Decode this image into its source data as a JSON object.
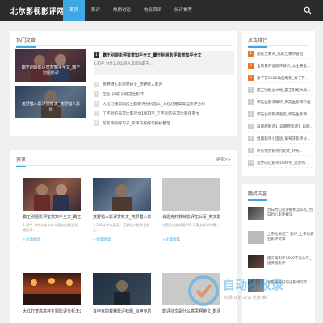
{
  "header": {
    "logo": "北尔影视影评网",
    "nav": [
      "首页",
      "影评",
      "热剧讨论",
      "电影资讯",
      "好评推荐"
    ],
    "active_nav": 0
  },
  "hot": {
    "title": "热门文章",
    "featured": [
      {
        "caption": "霸王别姬影评鉴赏知乎全文_霸王别姬影评"
      },
      {
        "caption": "荒野猎人影评赏析文_荒野猎人影评"
      }
    ],
    "top": {
      "number": "1",
      "title": "霸王别姬影评鉴赏知乎全文_霸王别姬影评鉴赏知乎全文",
      "desc": "1.知乎 为什么这么多人喜欢贴霸王..."
    },
    "list": [
      {
        "num": "2",
        "text": "荒野猎人影评赏析文_荒野猎人影评"
      },
      {
        "num": "3",
        "text": "茁壮 长城 长城茁壮影评"
      },
      {
        "num": "4",
        "text": "大红灯笼高高挂主题影评分析怎么_大红灯笼高高挂影评分析"
      },
      {
        "num": "5",
        "text": "了不起的盖茨比影评文1000字_了不起的盖茨比影评英文"
      },
      {
        "num": "6",
        "text": "写影评的好句子_影评写作好句摘抄整理"
      }
    ]
  },
  "news": {
    "title": "资讯",
    "more": "更多>>",
    "items": [
      {
        "title": "霸王别姬影评鉴赏知乎全文_霸王别姬",
        "desc": "1.知乎 为什么这么多人喜欢贴霸王别姬影评...",
        "more": "+文章阅读"
      },
      {
        "title": "荒野猎人影评赏析文_荒野猎人影评",
        "desc": "1.500字什么要买？荒野猎人影评赏析文...",
        "more": "+文章阅读"
      },
      {
        "title": "肖恩克的救赎影评怎么写_英文影评",
        "desc": "肖恩克的救赎影评1.写英文影评的基...",
        "more": "+文章阅读"
      },
      {
        "title": "大红灯笼高高挂主题影评分析怎么写",
        "desc": "",
        "more": ""
      },
      {
        "title": "肖申克的救赎影评标题_肖申克的救赎",
        "desc": "",
        "more": ""
      },
      {
        "title": "影评征文是什么意思啊英文_影评",
        "desc": "",
        "more": ""
      }
    ]
  },
  "rank": {
    "title": "点击排行",
    "items": [
      {
        "num": "1",
        "text": "黑蛇之象评_黑蛇之象评冒险"
      },
      {
        "num": "2",
        "text": "金牌黄内证影评解析_公主黄金..."
      },
      {
        "num": "3",
        "text": "秦子芥2020动画电影_秦子芥..."
      },
      {
        "num": "4",
        "text": "霸王别姬之大地_霸王别姬大地..."
      },
      {
        "num": "5",
        "text": "郭先生影评精华_郭先生影评介绍"
      },
      {
        "num": "6",
        "text": "郭先生的影评鉴赏_郭先生影评"
      },
      {
        "num": "7",
        "text": "白鹿原影评1_白鹿原影评1_白鹿..."
      },
      {
        "num": "8",
        "text": "经典影评小国语_葡萄牙影评分..."
      },
      {
        "num": "9",
        "text": "环形债务影评讨论文_环形..."
      },
      {
        "num": "10",
        "text": "追梦的心影评1000字_追梦的..."
      }
    ]
  },
  "random": {
    "title": "随机内容",
    "items": [
      {
        "text": "烈日灼心影评解析怎么写_烈日灼心影评解读"
      },
      {
        "text": "上帝也疯狂了 影评_上帝也疯狂影评文章"
      },
      {
        "text": "唐天喀影评1500字怎么写_唐天喀影评"
      },
      {
        "text": "写影评的好句子影评写作"
      }
    ]
  },
  "watermark": {
    "brand": "自动秒收录",
    "tagline": "收录·排名·来访·流量·推广"
  },
  "colors": {
    "accent": "#3ea8e5",
    "header_bg": "#2b2b2b",
    "rank_hot": "#e8762b"
  }
}
